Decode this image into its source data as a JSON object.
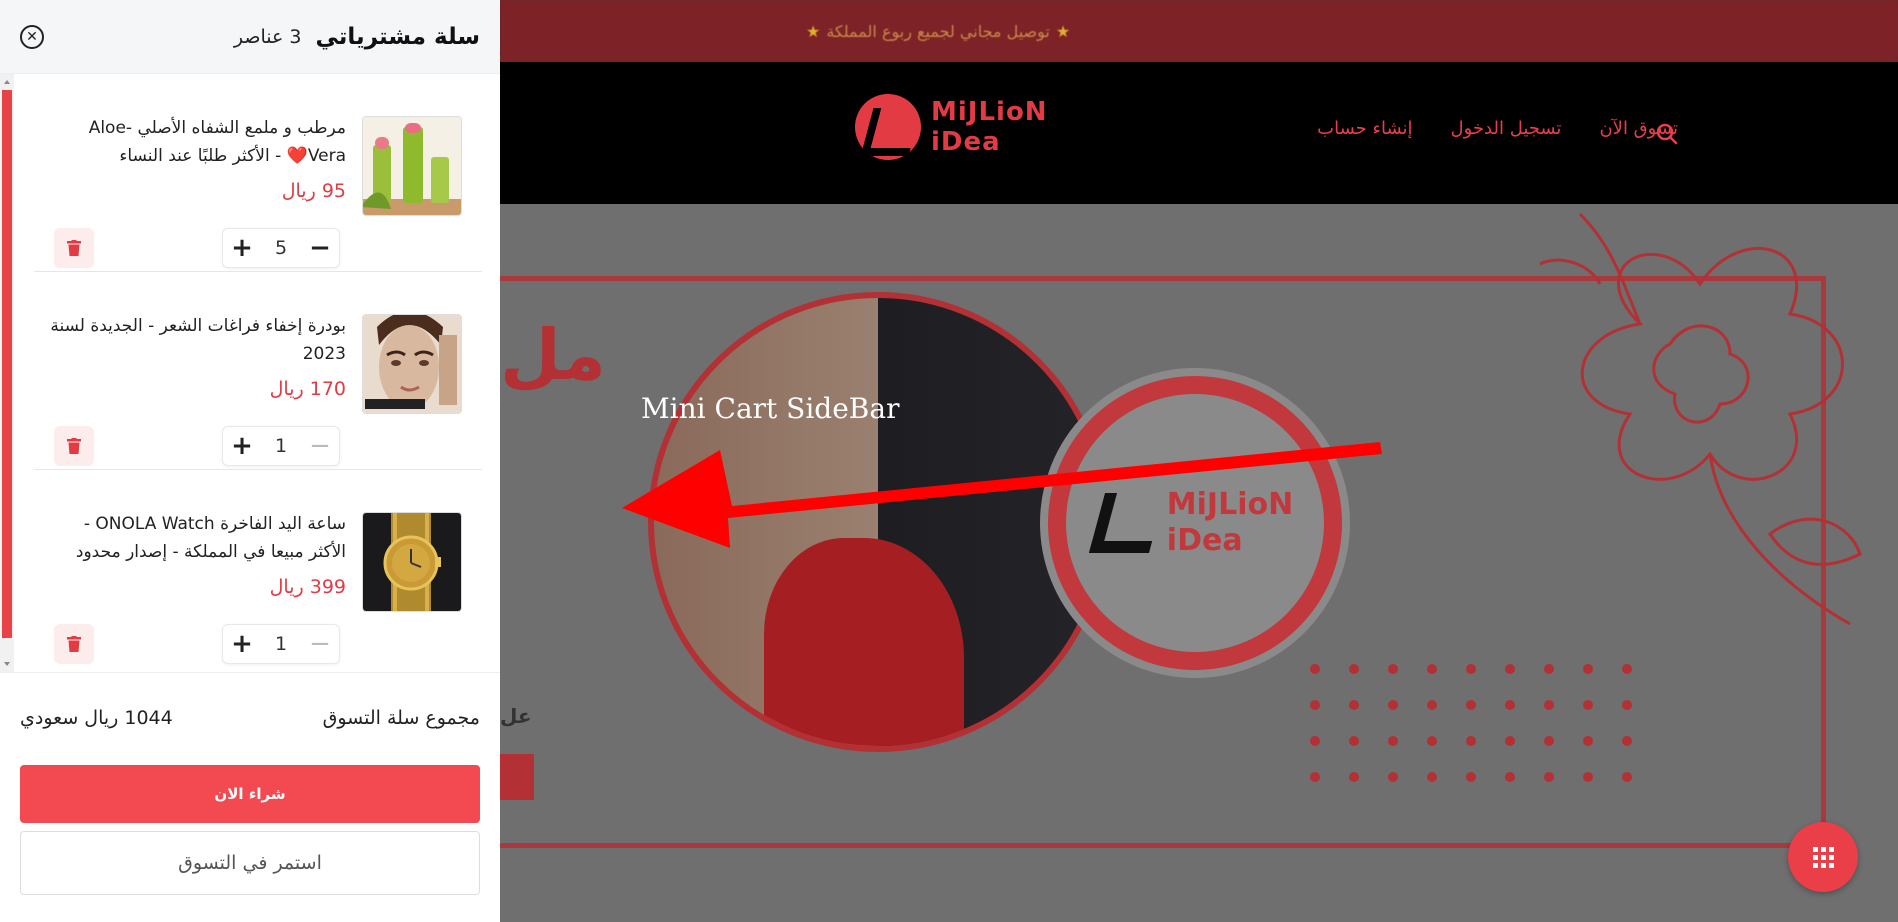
{
  "background": {
    "announcement": "توصيل مجاني لجميع ربوع المملكة",
    "logo_line1": "MiJLioN",
    "logo_line2": "iDea",
    "nav": [
      "تسوق الآن",
      "تسجيل الدخول",
      "إنشاء حساب"
    ],
    "hero_letters": "مل",
    "hero_small": "عل",
    "hero_logo_line1": "MiJLioN",
    "hero_logo_line2": "iDea",
    "colors": {
      "accent": "#ea3e49",
      "announce_bg": "#7d2226"
    }
  },
  "annotation": {
    "label": "Mini Cart SideBar",
    "color": "#ff0000"
  },
  "cart": {
    "title": "سلة مشترياتي",
    "count_text": "3 عناصر",
    "close_icon": "close-circle-icon",
    "items": [
      {
        "name": "مرطب و ملمع الشفاه الأصلي -Aloe Vera❤️ - الأكثر طلبًا عند النساء",
        "price": "95 ريال",
        "qty": "5",
        "image_icon": "lipstick-product-image"
      },
      {
        "name": "بودرة إخفاء فراغات الشعر - الجديدة لسنة 2023",
        "price": "170 ريال",
        "qty": "1",
        "image_icon": "brow-powder-product-image"
      },
      {
        "name": "ساعة اليد الفاخرة ONOLA Watch - الأكثر مبيعا في المملكة - إصدار محدود",
        "price": "399 ريال",
        "qty": "1",
        "image_icon": "gold-watch-product-image"
      }
    ],
    "total_label": "مجموع سلة التسوق",
    "total_value": "1044 ريال سعودي",
    "buy_label": "شراء الان",
    "continue_label": "استمر في التسوق"
  }
}
